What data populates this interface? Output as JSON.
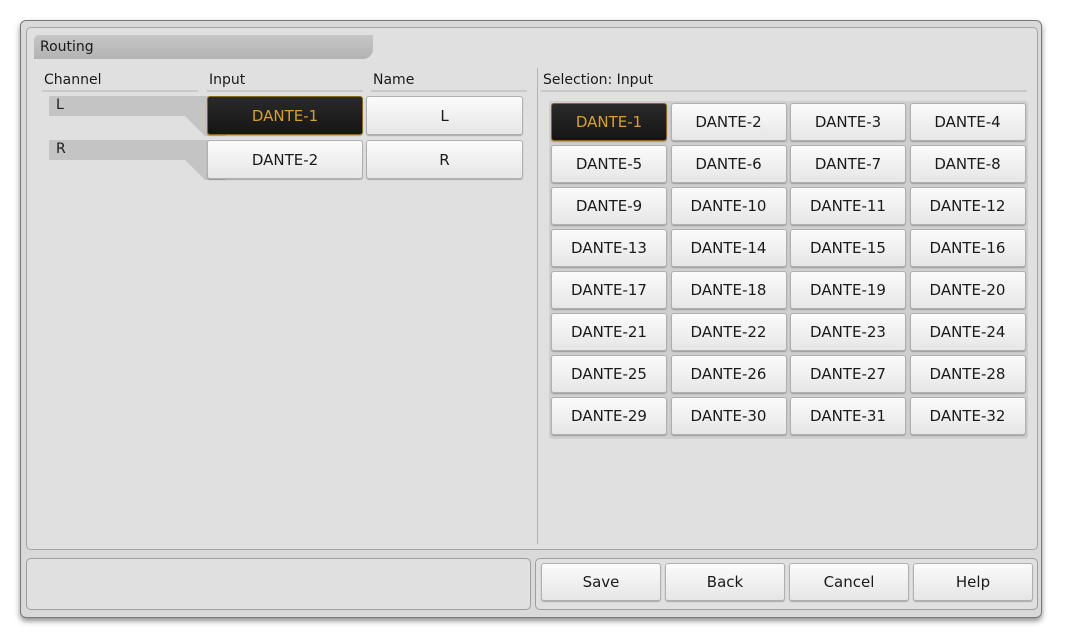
{
  "title": "Routing",
  "columns": {
    "channel": "Channel",
    "input": "Input",
    "name": "Name",
    "selection": "Selection: Input"
  },
  "channels": [
    {
      "label": "L",
      "input": "DANTE-1",
      "name": "L",
      "input_selected": true
    },
    {
      "label": "R",
      "input": "DANTE-2",
      "name": "R",
      "input_selected": false
    }
  ],
  "input_options": [
    "DANTE-1",
    "DANTE-2",
    "DANTE-3",
    "DANTE-4",
    "DANTE-5",
    "DANTE-6",
    "DANTE-7",
    "DANTE-8",
    "DANTE-9",
    "DANTE-10",
    "DANTE-11",
    "DANTE-12",
    "DANTE-13",
    "DANTE-14",
    "DANTE-15",
    "DANTE-16",
    "DANTE-17",
    "DANTE-18",
    "DANTE-19",
    "DANTE-20",
    "DANTE-21",
    "DANTE-22",
    "DANTE-23",
    "DANTE-24",
    "DANTE-25",
    "DANTE-26",
    "DANTE-27",
    "DANTE-28",
    "DANTE-29",
    "DANTE-30",
    "DANTE-31",
    "DANTE-32"
  ],
  "selected_option": "DANTE-1",
  "footer": {
    "save": "Save",
    "back": "Back",
    "cancel": "Cancel",
    "help": "Help"
  },
  "colors": {
    "selected_text": "#d8a030",
    "selected_bg": "#1c1c1c",
    "panel_bg": "#e0e0e0"
  }
}
